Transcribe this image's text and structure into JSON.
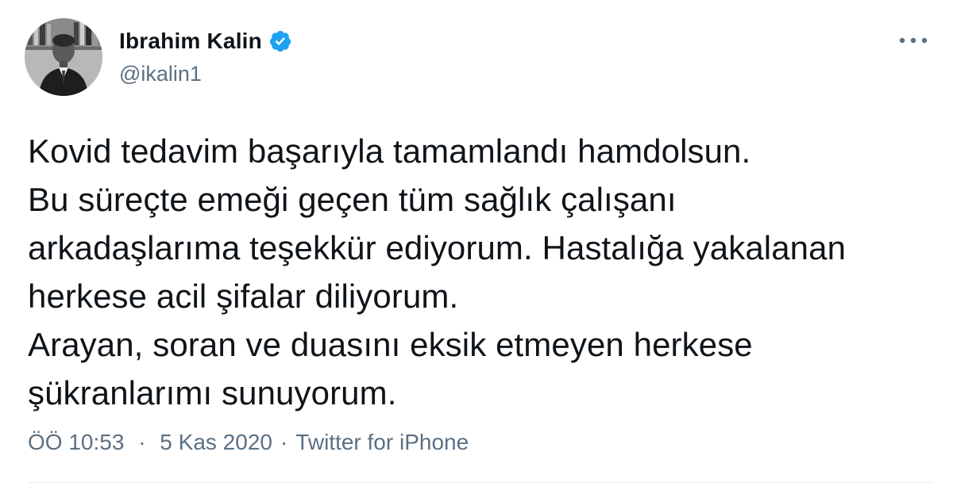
{
  "author": {
    "display_name": "Ibrahim Kalin",
    "handle": "@ikalin1",
    "verified": true
  },
  "tweet": {
    "text": "Kovid tedavim başarıyla tamamlandı hamdolsun.\nBu süreçte emeği geçen tüm sağlık çalışanı\narkadaşlarıma teşekkür ediyorum. Hastalığa yakalanan\nherkese acil şifalar diliyorum.\nArayan, soran ve duasını eksik etmeyen herkese\nşükranlarımı sunuyorum.",
    "time": "ÖÖ 10:53",
    "separator": "·",
    "date": "5 Kas 2020",
    "source": "Twitter for iPhone"
  },
  "icons": {
    "verified": "verified-badge-icon",
    "more": "more-dots-icon"
  },
  "colors": {
    "verified_blue": "#1da1f2",
    "secondary_text": "#5b7083",
    "primary_text": "#0f1419",
    "divider": "#e6ecf0"
  }
}
